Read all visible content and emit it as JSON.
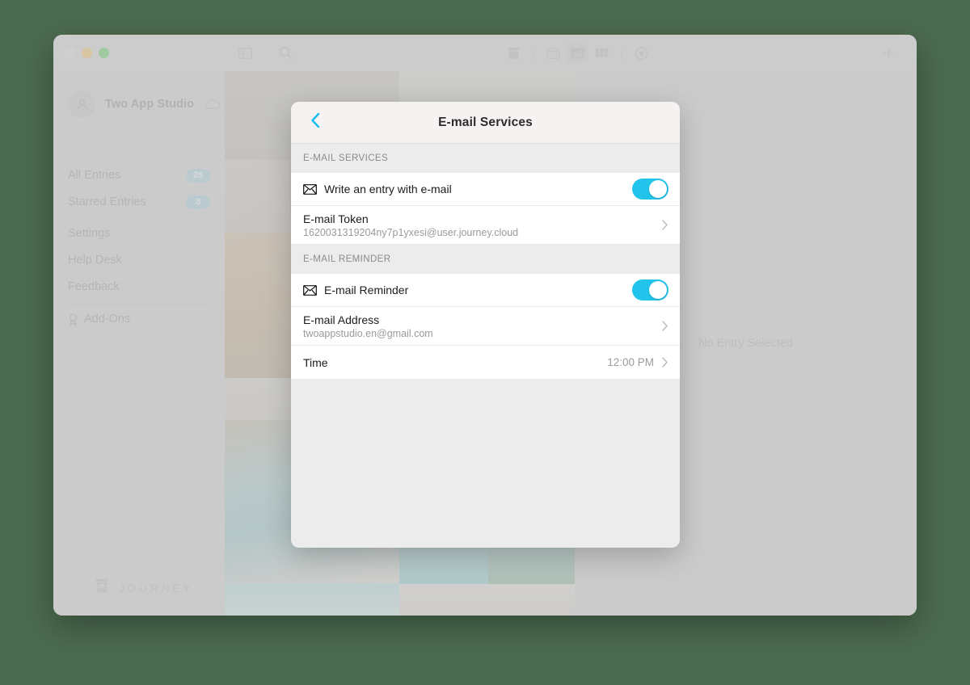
{
  "window": {
    "traffic_lights": [
      "close",
      "minimize",
      "maximize"
    ],
    "toolbar": {
      "sidebar_toggle_icon": "sidebar-icon",
      "search_icon": "search-icon",
      "view_icons": [
        "archive-icon",
        "calendar-icon",
        "photos-icon",
        "map-icon",
        "heart-icon"
      ],
      "selected_view": "photos-icon",
      "add_icon": "plus-icon"
    }
  },
  "sidebar": {
    "profile": {
      "name": "Two App Studio",
      "avatar_icon": "person-icon",
      "cloud_icon": "cloud-icon"
    },
    "items": [
      {
        "label": "All Entries",
        "badge": "25"
      },
      {
        "label": "Starred Entries",
        "badge": "3"
      },
      {
        "label": "Settings",
        "badge": ""
      },
      {
        "label": "Help Desk",
        "badge": ""
      },
      {
        "label": "Feedback",
        "badge": ""
      },
      {
        "label": "Add-Ons",
        "badge": "",
        "icon": "award-icon"
      }
    ],
    "footer": {
      "logo_icon": "journey-box-icon",
      "logo_text": "JOURNEY"
    }
  },
  "content": {
    "empty_state": "No Entry Selected"
  },
  "modal": {
    "back_icon": "chevron-left-icon",
    "title": "E-mail Services",
    "sections": [
      {
        "header": "E-MAIL SERVICES",
        "rows": [
          {
            "kind": "toggle",
            "icon": "envelope-icon",
            "title": "Write an entry with e-mail",
            "toggle_on": true
          },
          {
            "kind": "disclosure",
            "title": "E-mail Token",
            "subtitle": "1620031319204ny7p1yxesi@user.journey.cloud",
            "chevron": "chevron-right-icon"
          }
        ]
      },
      {
        "header": "E-MAIL REMINDER",
        "rows": [
          {
            "kind": "toggle",
            "icon": "envelope-icon",
            "title": "E-mail Reminder",
            "toggle_on": true
          },
          {
            "kind": "disclosure",
            "title": "E-mail Address",
            "subtitle": "twoappstudio.en@gmail.com",
            "chevron": "chevron-right-icon"
          },
          {
            "kind": "value",
            "title": "Time",
            "value": "12:00 PM",
            "chevron": "chevron-right-icon"
          }
        ]
      }
    ]
  },
  "colors": {
    "desktop_background": "#4c6b50",
    "accent_cyan": "#22c4ec",
    "badge_blue": "#8ec6d8",
    "window_chrome": "#cccccc",
    "modal_background": "#ececec",
    "modal_header": "#f6f2f1"
  }
}
